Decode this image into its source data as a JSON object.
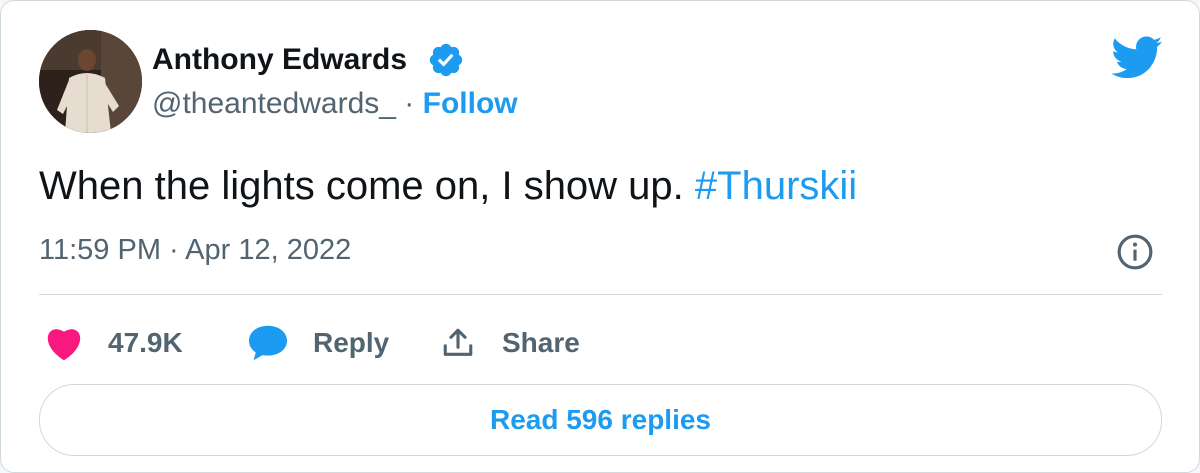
{
  "user": {
    "name": "Anthony Edwards",
    "handle": "@theantedwards_",
    "separator": "·",
    "follow_label": "Follow",
    "verified_icon": "verified-badge-icon",
    "avatar": "profile-photo"
  },
  "brand": {
    "logo_icon": "twitter-bird-icon",
    "accent_color": "#1d9bf0"
  },
  "tweet": {
    "text": "When the lights come on, I show up.",
    "hashtag": "#Thurskii",
    "timestamp": "11:59 PM · Apr 12, 2022",
    "info_icon": "info-icon"
  },
  "actions": {
    "likes_count": "47.9K",
    "like_icon": "heart-icon",
    "like_color": "#f91880",
    "reply_label": "Reply",
    "reply_icon": "speech-bubble-icon",
    "share_label": "Share",
    "share_icon": "share-icon"
  },
  "read_replies_label": "Read 596 replies"
}
